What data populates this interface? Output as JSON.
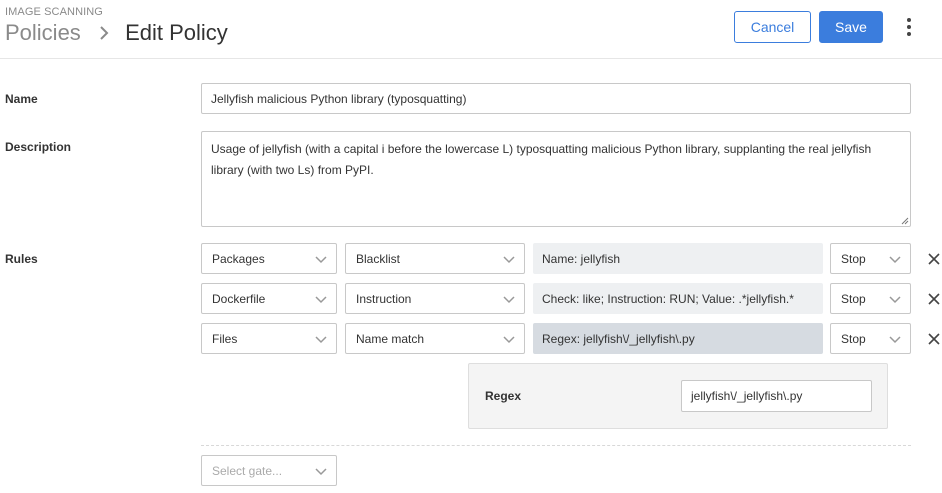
{
  "header": {
    "subtitle": "IMAGE SCANNING",
    "breadcrumb_root": "Policies",
    "breadcrumb_current": "Edit Policy",
    "cancel_label": "Cancel",
    "save_label": "Save"
  },
  "form": {
    "name_label": "Name",
    "name_value": "Jellyfish malicious Python library (typosquatting)",
    "description_label": "Description",
    "description_value": "Usage of jellyfish (with a capital i before the lowercase L) typosquatting malicious Python library, supplanting the real jellyfish library (with two Ls) from PyPI.",
    "rules_label": "Rules"
  },
  "rules": [
    {
      "gate": "Packages",
      "trigger": "Blacklist",
      "params": "Name: jellyfish",
      "action": "Stop"
    },
    {
      "gate": "Dockerfile",
      "trigger": "Instruction",
      "params": "Check: like; Instruction: RUN; Value: .*jellyfish.*",
      "action": "Stop"
    },
    {
      "gate": "Files",
      "trigger": "Name match",
      "params": "Regex: jellyfish\\/_jellyfish\\.py",
      "action": "Stop"
    }
  ],
  "param_editor": {
    "label": "Regex",
    "value": "jellyfish\\/_jellyfish\\.py"
  },
  "new_rule": {
    "placeholder": "Select gate..."
  },
  "colors": {
    "accent": "#3b7ddd",
    "readout_bg": "#eef0f2",
    "readout_active_bg": "#d6dbe1"
  }
}
